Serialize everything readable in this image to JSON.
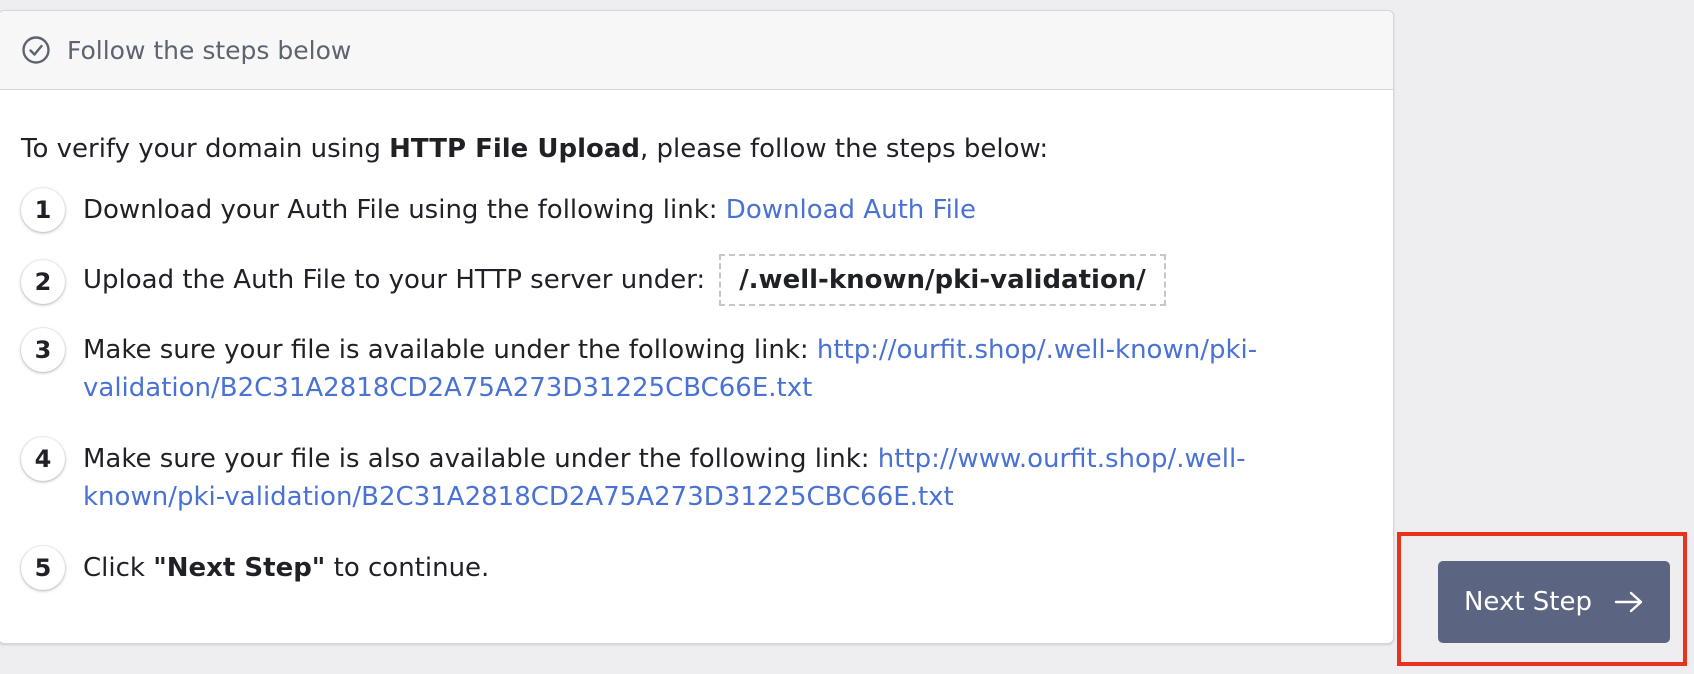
{
  "panel": {
    "title": "Follow the steps below",
    "icon": "check-circle-icon"
  },
  "intro": {
    "prefix": "To verify your domain using ",
    "method": "HTTP File Upload",
    "suffix": ", please follow the steps below:"
  },
  "steps": [
    {
      "number": "1",
      "text": "Download your Auth File using the following link: ",
      "link": "Download Auth File"
    },
    {
      "number": "2",
      "text": "Upload the Auth File to your HTTP server under:",
      "path": "/.well-known/pki-validation/"
    },
    {
      "number": "3",
      "text": "Make sure your file is available under the following link: ",
      "link": "http://ourfit.shop/.well-known/pki-validation/B2C31A2818CD2A75A273D31225CBC66E.txt"
    },
    {
      "number": "4",
      "text": "Make sure your file is also available under the following link: ",
      "link": "http://www.ourfit.shop/.well-known/pki-validation/B2C31A2818CD2A75A273D31225CBC66E.txt"
    },
    {
      "number": "5",
      "prefix": "Click ",
      "bold": "\"Next Step\"",
      "suffix": " to continue."
    }
  ],
  "next_button": {
    "label": "Next Step",
    "icon": "arrow-right-icon"
  },
  "colors": {
    "link": "#4a72d4",
    "button_bg": "#5b6581",
    "highlight": "#e8321e",
    "page_bg": "#eeeef0"
  }
}
